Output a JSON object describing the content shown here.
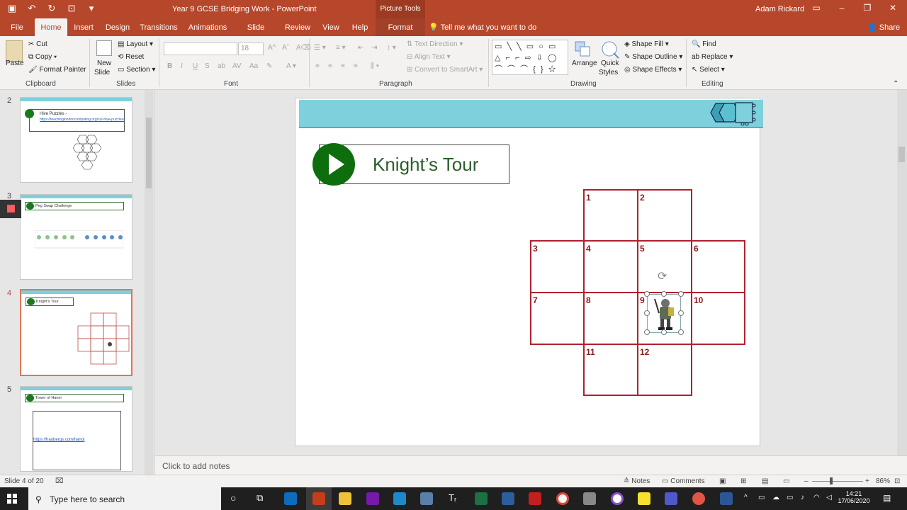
{
  "titlebar": {
    "document_title": "Year 9 GCSE Bridging Work  -  PowerPoint",
    "context_label": "Picture Tools",
    "user": "Adam Rickard",
    "minimize": "–",
    "restore": "❐",
    "close": "✕"
  },
  "tabs": [
    "File",
    "Home",
    "Insert",
    "Design",
    "Transitions",
    "Animations",
    "Slide Show",
    "Review",
    "View",
    "Help",
    "Format"
  ],
  "tell_me": "Tell me what you want to do",
  "share": "Share",
  "ribbon": {
    "clipboard": {
      "paste": "Paste",
      "cut": "Cut",
      "copy": "Copy",
      "format_painter": "Format Painter",
      "label": "Clipboard"
    },
    "slides": {
      "new_slide_1": "New",
      "new_slide_2": "Slide",
      "layout": "Layout",
      "reset": "Reset",
      "section": "Section",
      "label": "Slides"
    },
    "font": {
      "font_size": "18",
      "bold": "B",
      "italic": "I",
      "underline": "U",
      "strike": "S",
      "label": "Font"
    },
    "paragraph": {
      "text_direction": "Text Direction",
      "align_text": "Align Text",
      "convert_smartart": "Convert to SmartArt",
      "label": "Paragraph"
    },
    "drawing": {
      "arrange": "Arrange",
      "quick_styles_1": "Quick",
      "quick_styles_2": "Styles",
      "shape_fill": "Shape Fill",
      "shape_outline": "Shape Outline",
      "shape_effects": "Shape Effects",
      "label": "Drawing"
    },
    "editing": {
      "find": "Find",
      "replace": "Replace",
      "select": "Select",
      "label": "Editing"
    }
  },
  "thumbnails": [
    {
      "num": "2",
      "title": "Hive Puzzles -",
      "link": "https://teachinglondoncomputing.org/cut-hive-puzzles/"
    },
    {
      "num": "3",
      "title": "Peg Swap Challenge"
    },
    {
      "num": "4",
      "title": "Knight's Tour"
    },
    {
      "num": "5",
      "title": "Tower of Hanoi",
      "link": "https://haubergs.com/hanoi"
    }
  ],
  "slide": {
    "title": "Knight’s Tour",
    "cells": [
      "1",
      "2",
      "3",
      "4",
      "5",
      "6",
      "7",
      "8",
      "9",
      "10",
      "11",
      "12"
    ]
  },
  "notes_placeholder": "Click to add notes",
  "status": {
    "slide_counter": "Slide 4 of 20",
    "notes": "Notes",
    "comments": "Comments",
    "zoom": "86%"
  },
  "taskbar": {
    "search_placeholder": "Type here to search",
    "time": "14:21",
    "date": "17/06/2020"
  },
  "colors": {
    "accent": "#b7472a",
    "banner": "#7dd0dc",
    "grid": "#b0202f",
    "play": "#0e6e0e"
  }
}
